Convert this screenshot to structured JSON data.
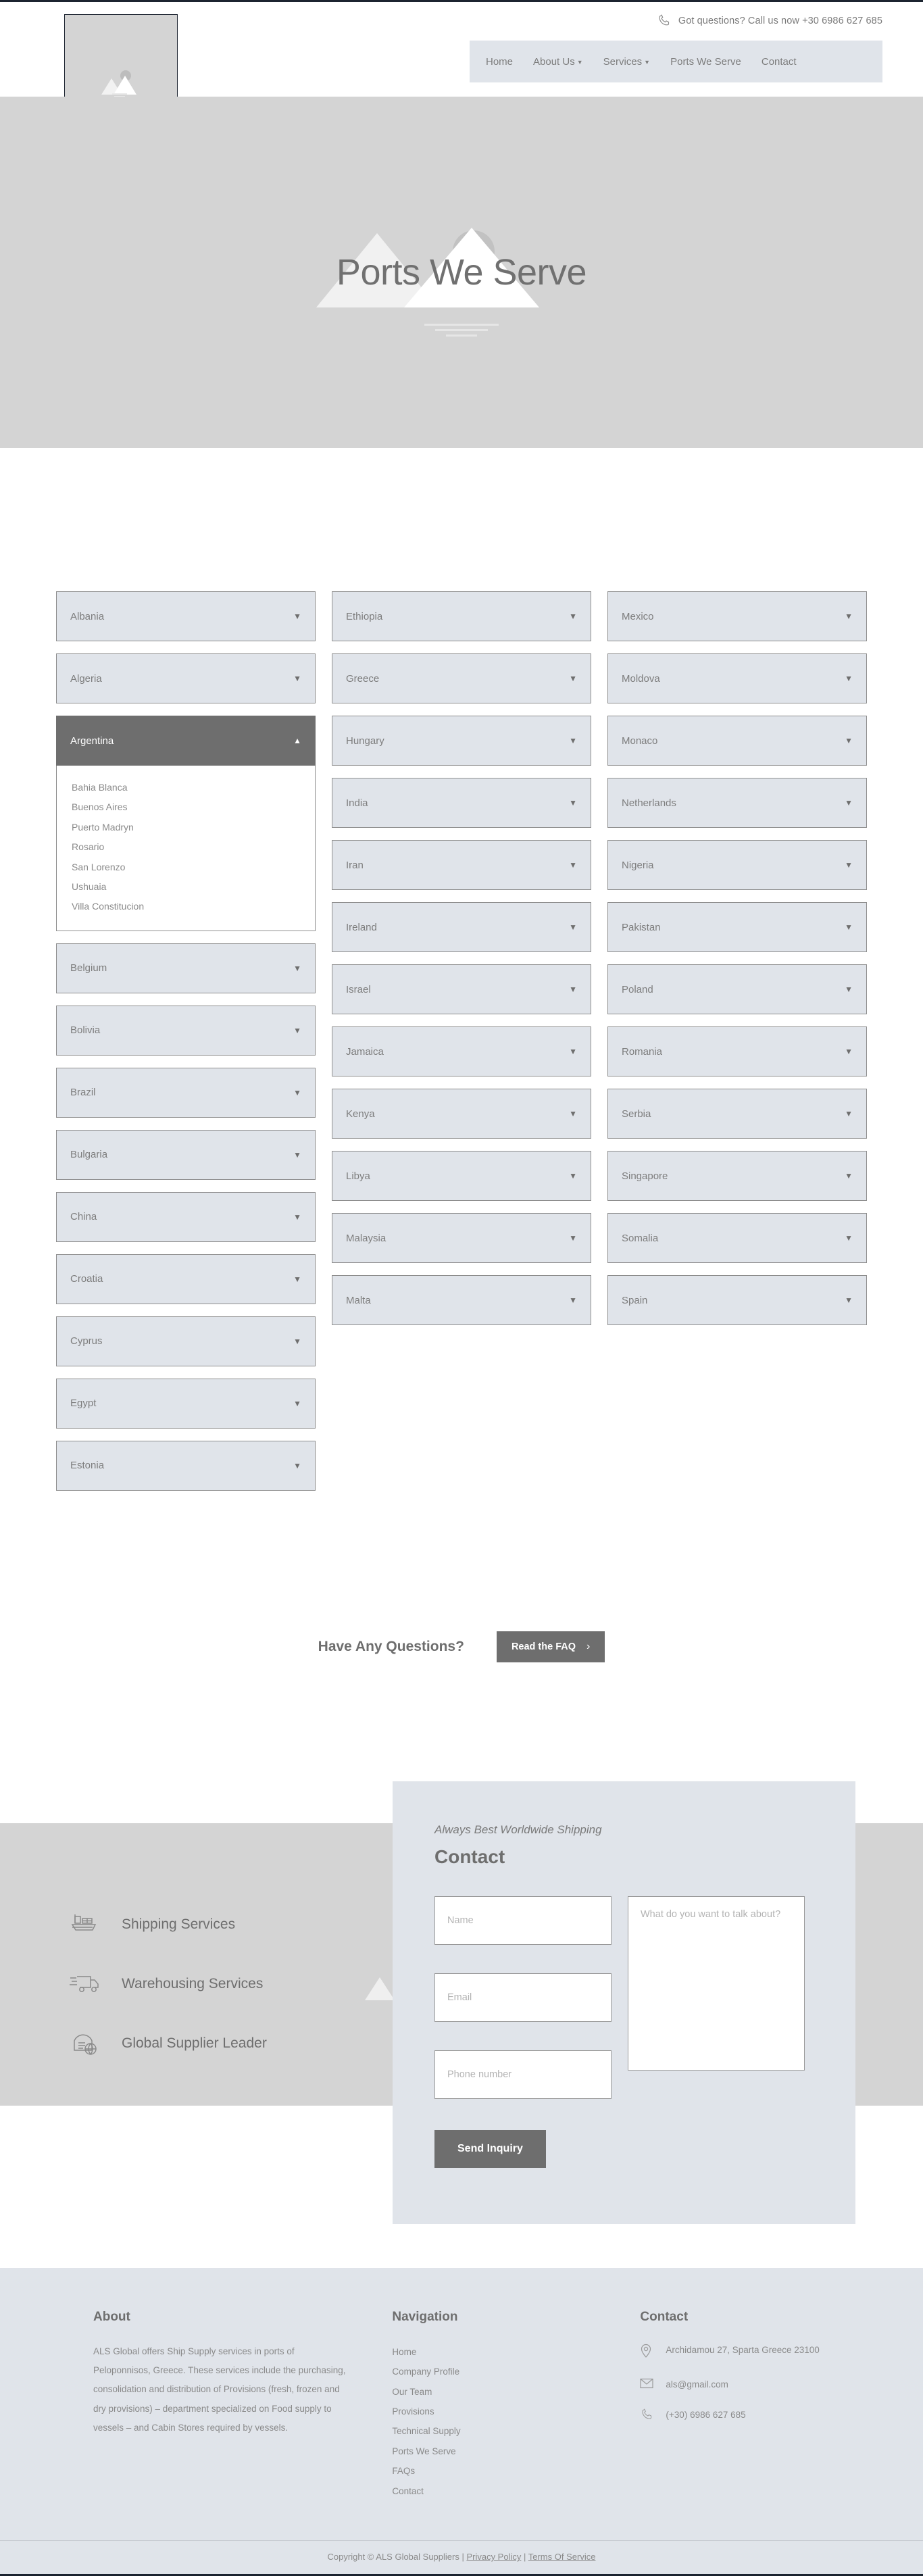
{
  "header": {
    "phone_text": "Got questions? Call us now +30 6986 627 685",
    "phone_icon": "phone-icon",
    "logo_alt": "broken-image-placeholder",
    "nav": [
      {
        "label": "Home",
        "has_caret": false
      },
      {
        "label": "About Us",
        "has_caret": true
      },
      {
        "label": "Services",
        "has_caret": true
      },
      {
        "label": "Ports We Serve",
        "has_caret": false
      },
      {
        "label": "Contact",
        "has_caret": false
      }
    ],
    "caret_glyph": "▼"
  },
  "hero": {
    "title": "Ports We Serve"
  },
  "ports": {
    "arrow_closed": "▼",
    "arrow_open": "▲",
    "columns": [
      {
        "items": [
          {
            "country": "Albania",
            "open": false,
            "ports": []
          },
          {
            "country": "Algeria",
            "open": false,
            "ports": []
          },
          {
            "country": "Argentina",
            "open": true,
            "ports": [
              "Bahia Blanca",
              "Buenos Aires",
              "Puerto Madryn",
              "Rosario",
              "San Lorenzo",
              "Ushuaia",
              "Villa Constitucion"
            ]
          },
          {
            "country": "Belgium",
            "open": false,
            "ports": []
          },
          {
            "country": "Bolivia",
            "open": false,
            "ports": []
          },
          {
            "country": "Brazil",
            "open": false,
            "ports": []
          },
          {
            "country": "Bulgaria",
            "open": false,
            "ports": []
          },
          {
            "country": "China",
            "open": false,
            "ports": []
          },
          {
            "country": "Croatia",
            "open": false,
            "ports": []
          },
          {
            "country": "Cyprus",
            "open": false,
            "ports": []
          },
          {
            "country": "Egypt",
            "open": false,
            "ports": []
          },
          {
            "country": "Estonia",
            "open": false,
            "ports": []
          }
        ]
      },
      {
        "items": [
          {
            "country": "Ethiopia",
            "open": false,
            "ports": []
          },
          {
            "country": "Greece",
            "open": false,
            "ports": []
          },
          {
            "country": "Hungary",
            "open": false,
            "ports": []
          },
          {
            "country": "India",
            "open": false,
            "ports": []
          },
          {
            "country": "Iran",
            "open": false,
            "ports": []
          },
          {
            "country": "Ireland",
            "open": false,
            "ports": []
          },
          {
            "country": "Israel",
            "open": false,
            "ports": []
          },
          {
            "country": "Jamaica",
            "open": false,
            "ports": []
          },
          {
            "country": "Kenya",
            "open": false,
            "ports": []
          },
          {
            "country": "Libya",
            "open": false,
            "ports": []
          },
          {
            "country": "Malaysia",
            "open": false,
            "ports": []
          },
          {
            "country": "Malta",
            "open": false,
            "ports": []
          }
        ]
      },
      {
        "items": [
          {
            "country": "Mexico",
            "open": false,
            "ports": []
          },
          {
            "country": "Moldova",
            "open": false,
            "ports": []
          },
          {
            "country": "Monaco",
            "open": false,
            "ports": []
          },
          {
            "country": "Netherlands",
            "open": false,
            "ports": []
          },
          {
            "country": "Nigeria",
            "open": false,
            "ports": []
          },
          {
            "country": "Pakistan",
            "open": false,
            "ports": []
          },
          {
            "country": "Poland",
            "open": false,
            "ports": []
          },
          {
            "country": "Romania",
            "open": false,
            "ports": []
          },
          {
            "country": "Serbia",
            "open": false,
            "ports": []
          },
          {
            "country": "Singapore",
            "open": false,
            "ports": []
          },
          {
            "country": "Somalia",
            "open": false,
            "ports": []
          },
          {
            "country": "Spain",
            "open": false,
            "ports": []
          }
        ]
      }
    ]
  },
  "faq": {
    "heading": "Have Any Questions?",
    "button_label": "Read the FAQ",
    "button_chevron": "›"
  },
  "services": [
    {
      "label": "Shipping Services",
      "icon": "cargo-ship-icon"
    },
    {
      "label": "Warehousing Services",
      "icon": "delivery-truck-icon"
    },
    {
      "label": "Global Supplier Leader",
      "icon": "global-warehouse-icon"
    }
  ],
  "contact_card": {
    "kicker": "Always Best Worldwide Shipping",
    "title": "Contact",
    "name_placeholder": "Name",
    "email_placeholder": "Email",
    "phone_placeholder": "Phone number",
    "message_placeholder": "What do you want to talk about?",
    "submit_label": "Send Inquiry"
  },
  "footer": {
    "about_heading": "About",
    "about_text": "ALS Global offers Ship Supply services in ports of Peloponnisos, Greece. These services include the purchasing, consolidation and distribution of Provisions (fresh, frozen and dry provisions) – department specialized on Food supply to vessels – and Cabin Stores required by vessels.",
    "nav_heading": "Navigation",
    "nav_items": [
      "Home",
      "Company Profile",
      "Our Team",
      "Provisions",
      "Technical Supply",
      "Ports We Serve",
      "FAQs",
      "Contact"
    ],
    "contact_heading": "Contact",
    "address": "Archidamou 27, Sparta Greece 23100",
    "email": "als@gmail.com",
    "phone": "(+30) 6986 627 685",
    "copyright_prefix": "Copyright © ALS Global Suppliers | ",
    "privacy_label": "Privacy Policy",
    "copyright_sep": " | ",
    "terms_label": "Terms Of Service"
  },
  "colors": {
    "accent_dark": "#6e6e6e",
    "panel": "#e0e4ea",
    "hero_bg": "#d4d4d4",
    "text": "#8a8a8a"
  }
}
